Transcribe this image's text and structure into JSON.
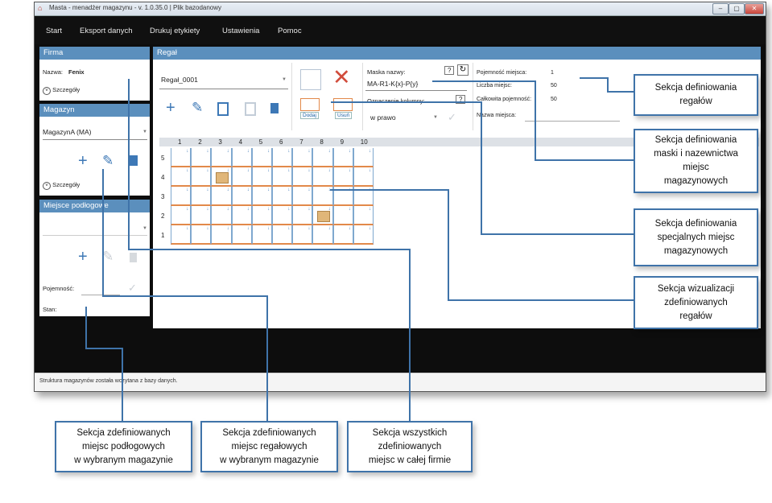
{
  "window": {
    "title": "Masta - menadżer magazynu - v. 1.0.35.0 | Plik bazodanowy",
    "buttons": [
      "–",
      "▢",
      "✕"
    ]
  },
  "menu": [
    "Start",
    "Eksport danych",
    "Drukuj etykiety",
    "Ustawienia",
    "Pomoc"
  ],
  "firma": {
    "header": "Firma",
    "name_label": "Nazwa:",
    "name_value": "Fenix",
    "details_label": "Szczegóły"
  },
  "magazyn": {
    "header": "Magazyn",
    "selected": "MagazynA (MA)",
    "details_label": "Szczegóły"
  },
  "miejsce_podlogowe": {
    "header": "Miejsce podłogowe",
    "capacity_label": "Pojemność:",
    "state_label": "Stan:"
  },
  "regal": {
    "header": "Regał",
    "selected": "Regał_0001",
    "special_add": "Dodaj",
    "special_remove": "Usuń",
    "mask_label": "Maska nazwy:",
    "mask_help": "?",
    "mask_value": "MA-R1-K{x}-P{y}",
    "column_label": "Oznaczenie kolumny:",
    "column_help": "?",
    "column_value": "w prawo",
    "capacity_label": "Pojemność miejsca:",
    "capacity_value": "1",
    "count_label": "Liczba miejsc:",
    "count_value": "50",
    "total_label": "Całkowita pojemność:",
    "total_value": "50",
    "place_name_label": "Nazwa miejsca:",
    "columns": [
      "1",
      "2",
      "3",
      "4",
      "5",
      "6",
      "7",
      "8",
      "9",
      "10"
    ],
    "rows": [
      "5",
      "4",
      "3",
      "2",
      "1"
    ],
    "special_cells": [
      {
        "col": 3,
        "row": 4
      },
      {
        "col": 8,
        "row": 2
      }
    ]
  },
  "status": "Struktura magazynów została wczytana z bazy danych.",
  "callouts": {
    "regaly": "Sekcja definiowania\nregałów",
    "maska": "Sekcja definiowania\nmaski i nazewnictwa\nmiejsc\nmagazynowych",
    "specjalne": "Sekcja definiowania\nspecjalnych miejsc\nmagazynowych",
    "wizualizacja": "Sekcja wizualizacji\nzdefiniowanych\nregałów",
    "podlogowe": "Sekcja zdefiniowanych\nmiejsc podłogowych\nw wybranym magazynie",
    "regalowe": "Sekcja zdefiniowanych\nmiejsc regałowych\nw wybranym magazynie",
    "wszystkie": "Sekcja wszystkich\nzdefiniowanych\nmiejsc w całej firmie"
  },
  "colors": {
    "panel_header": "#5b8fbd",
    "accent_blue": "#3d78b6",
    "grid_line": "#e2894a",
    "callout_border": "#3f73a9"
  }
}
